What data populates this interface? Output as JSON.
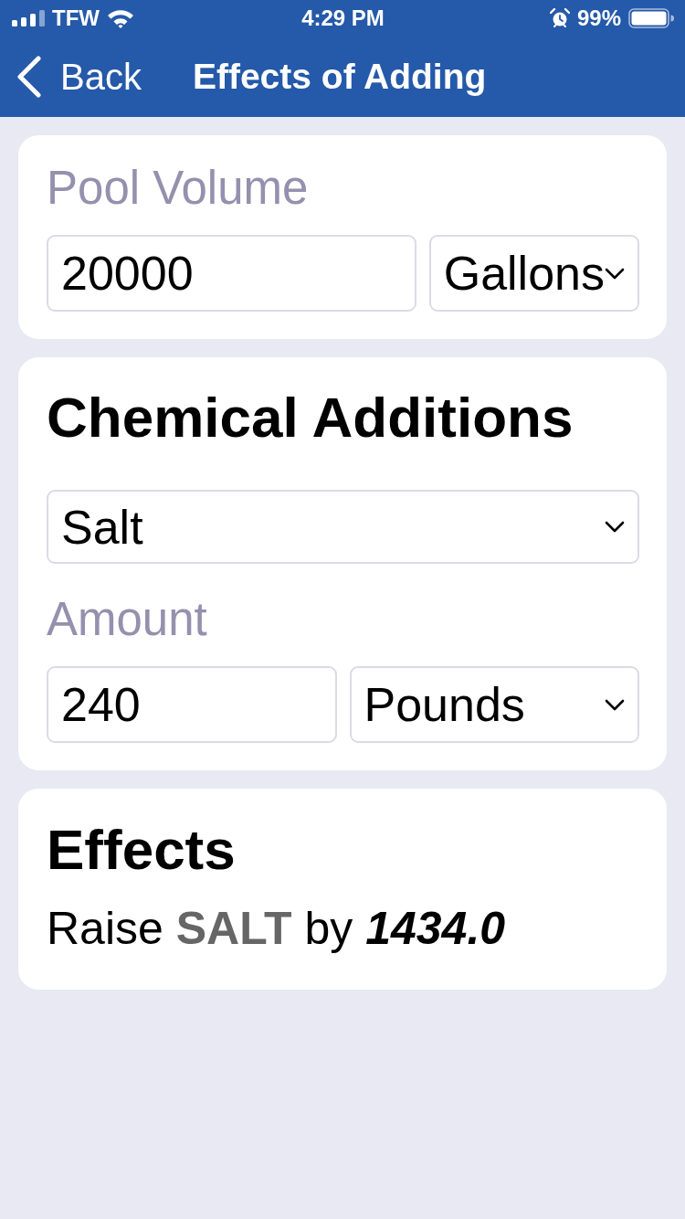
{
  "status_bar": {
    "carrier": "TFW",
    "time": "4:29 PM",
    "battery": "99%"
  },
  "nav_bar": {
    "back": "Back",
    "title": "Effects of Adding"
  },
  "pool_volume": {
    "label": "Pool Volume",
    "value": "20000",
    "unit": "Gallons"
  },
  "chemical_additions": {
    "title": "Chemical Additions",
    "chemical": "Salt",
    "amount_label": "Amount",
    "amount": "240",
    "unit": "Pounds"
  },
  "effects": {
    "title": "Effects",
    "result": "Raise **SALT** by *1434.0*"
  }
}
